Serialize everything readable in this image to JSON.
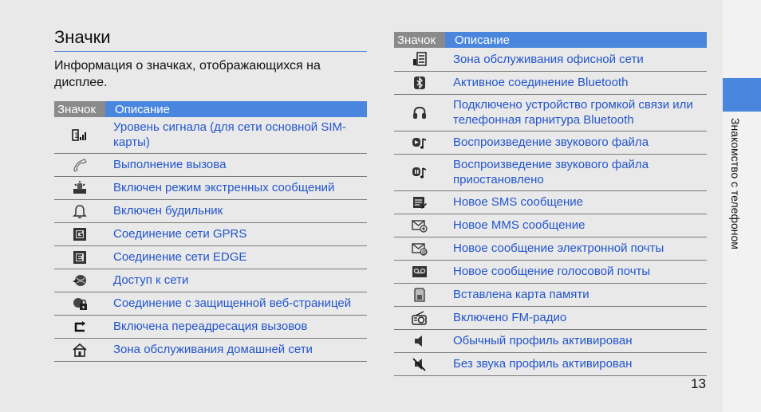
{
  "section_title": "Значки",
  "intro": "Информация о значках, отображающихся на дисплее.",
  "side_label": "Знакомство с телефоном",
  "page_number": "13",
  "accent_color": "#4a86dd",
  "header_gray": "#8a8a8a",
  "link_color": "#2255cc",
  "table_headers": {
    "icon": "Значок",
    "description": "Описание"
  },
  "left_rows": [
    {
      "icon": "signal-strength-icon",
      "description": "Уровень сигнала (для сети основной SIM-карты)"
    },
    {
      "icon": "call-in-progress-icon",
      "description": "Выполнение вызова"
    },
    {
      "icon": "sos-mode-icon",
      "description": "Включен режим экстренных сообщений"
    },
    {
      "icon": "alarm-bell-icon",
      "description": "Включен будильник"
    },
    {
      "icon": "gprs-icon",
      "description": "Соединение сети GPRS"
    },
    {
      "icon": "edge-icon",
      "description": "Соединение сети EDGE"
    },
    {
      "icon": "network-access-icon",
      "description": "Доступ к сети"
    },
    {
      "icon": "secure-web-icon",
      "description": "Соединение с защищенной веб-страницей"
    },
    {
      "icon": "call-forwarding-icon",
      "description": "Включена переадресация вызовов"
    },
    {
      "icon": "home-zone-icon",
      "description": "Зона обслуживания домашней сети"
    }
  ],
  "right_rows": [
    {
      "icon": "office-zone-icon",
      "description": "Зона обслуживания офисной сети"
    },
    {
      "icon": "bluetooth-icon",
      "description": "Активное соединение Bluetooth"
    },
    {
      "icon": "bluetooth-headset-icon",
      "description": "Подключено устройство громкой связи или телефонная гарнитура Bluetooth"
    },
    {
      "icon": "music-play-icon",
      "description": "Воспроизведение звукового файла"
    },
    {
      "icon": "music-pause-icon",
      "description": "Воспроизведение звукового файла приостановлено"
    },
    {
      "icon": "sms-icon",
      "description": "Новое SMS сообщение"
    },
    {
      "icon": "mms-icon",
      "description": "Новое MMS сообщение"
    },
    {
      "icon": "email-icon",
      "description": "Новое сообщение электронной почты"
    },
    {
      "icon": "voicemail-icon",
      "description": "Новое сообщение голосовой почты"
    },
    {
      "icon": "memory-card-icon",
      "description": "Вставлена карта памяти"
    },
    {
      "icon": "fm-radio-icon",
      "description": "Включено FM-радио"
    },
    {
      "icon": "normal-profile-icon",
      "description": "Обычный профиль активирован"
    },
    {
      "icon": "silent-profile-icon",
      "description": "Без звука профиль активирован"
    }
  ]
}
